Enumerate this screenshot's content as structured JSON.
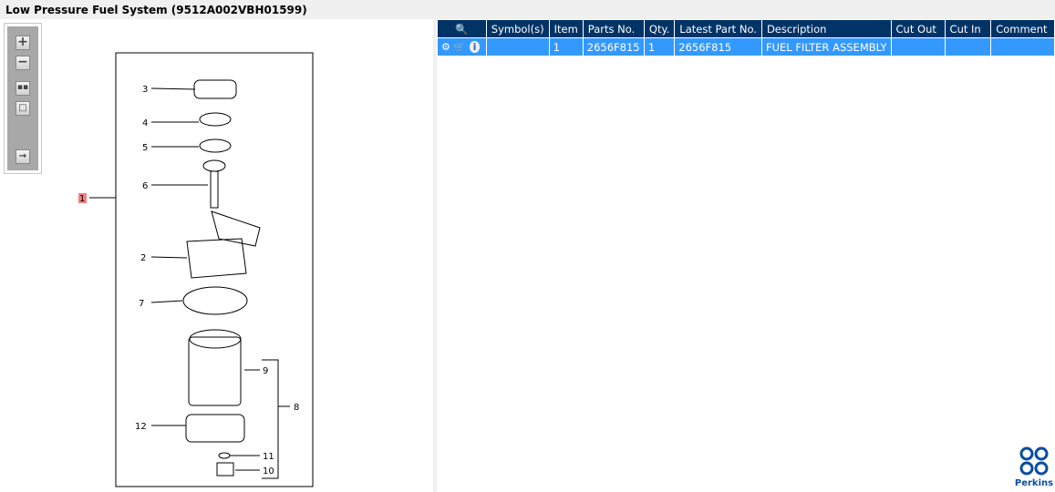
{
  "title": "Low Pressure Fuel System (9512A002VBH01599)",
  "toolbar": {
    "zoom_in": "zoom-in",
    "zoom_out": "zoom-out",
    "fit": "fit",
    "actual": "actual",
    "export": "export"
  },
  "diagram": {
    "callouts": [
      "1",
      "2",
      "3",
      "4",
      "5",
      "6",
      "7",
      "8",
      "9",
      "10",
      "11",
      "12"
    ]
  },
  "table": {
    "headers": [
      "Symbol(s)",
      "Item",
      "Parts No.",
      "Qty.",
      "Latest Part No.",
      "Description",
      "Cut Out",
      "Cut In",
      "Comment"
    ],
    "rows": [
      {
        "symbols": "",
        "item": "1",
        "parts_no": "2656F815",
        "qty": "1",
        "latest_part_no": "2656F815",
        "description": "FUEL FILTER ASSEMBLY",
        "cut_out": "",
        "cut_in": "",
        "comment": ""
      }
    ]
  },
  "brand": "Perkins"
}
